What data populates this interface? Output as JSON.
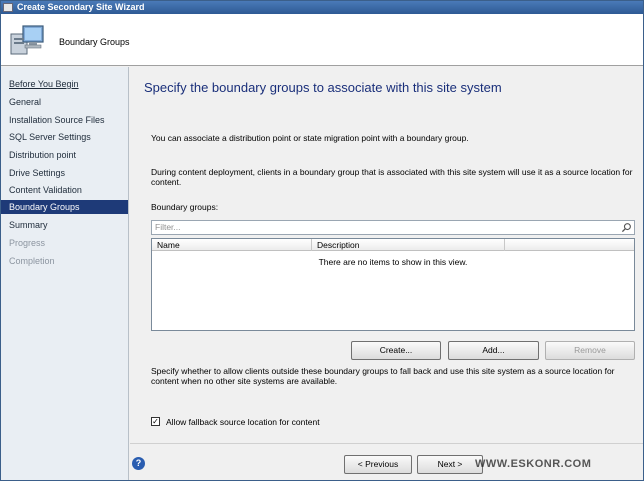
{
  "window": {
    "title": "Create Secondary Site Wizard"
  },
  "header": {
    "title": "Boundary Groups",
    "icon": "computer-icon"
  },
  "sidebar": {
    "items": [
      {
        "label": "Before You Begin",
        "state": "link"
      },
      {
        "label": "General",
        "state": "normal"
      },
      {
        "label": "Installation Source Files",
        "state": "normal"
      },
      {
        "label": "SQL Server Settings",
        "state": "normal"
      },
      {
        "label": "Distribution point",
        "state": "normal"
      },
      {
        "label": "Drive Settings",
        "state": "normal"
      },
      {
        "label": "Content Validation",
        "state": "normal"
      },
      {
        "label": "Boundary Groups",
        "state": "active"
      },
      {
        "label": "Summary",
        "state": "normal"
      },
      {
        "label": "Progress",
        "state": "disabled"
      },
      {
        "label": "Completion",
        "state": "disabled"
      }
    ]
  },
  "main": {
    "heading": "Specify the boundary groups to associate with this site system",
    "intro": "You can associate a distribution point or state migration point with a boundary group.",
    "deployment_note": "During content deployment, clients in a boundary group that is associated with this site system will use it as a source location for content.",
    "boundary_groups_label": "Boundary groups:",
    "filter_placeholder": "Filter...",
    "columns": [
      "Name",
      "Description"
    ],
    "empty_message": "There are no items to show in this view.",
    "buttons": {
      "create": "Create...",
      "add": "Add...",
      "remove": "Remove"
    },
    "fallback_note": "Specify whether to allow clients outside these boundary groups to fall back and use this site system as a source location for content when no other site systems are available.",
    "fallback_checkbox": {
      "label": "Allow fallback source location for content",
      "checked": true
    }
  },
  "footer": {
    "previous": "< Previous",
    "next": "Next >",
    "watermark": "WWW.ESKONR.COM"
  },
  "colors": {
    "active_nav": "#1e3a78",
    "heading": "#1a2f7a",
    "titlebar": "#2e5a94"
  }
}
